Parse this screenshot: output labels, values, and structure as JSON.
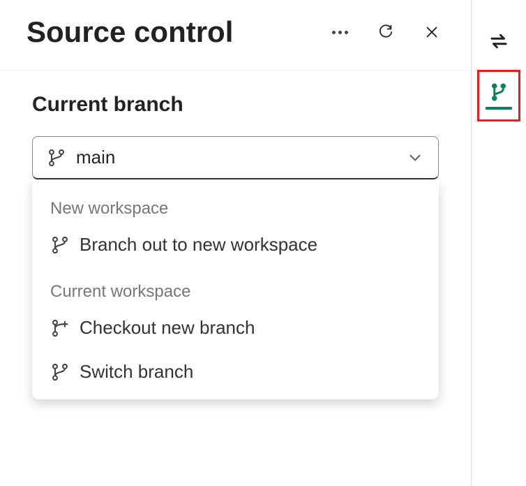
{
  "header": {
    "title": "Source control"
  },
  "section": {
    "label": "Current branch"
  },
  "dropdown": {
    "value": "main"
  },
  "menu": {
    "group_new_workspace": "New workspace",
    "branch_out": "Branch out to new workspace",
    "group_current_workspace": "Current workspace",
    "checkout_new_branch": "Checkout new branch",
    "switch_branch": "Switch branch"
  }
}
